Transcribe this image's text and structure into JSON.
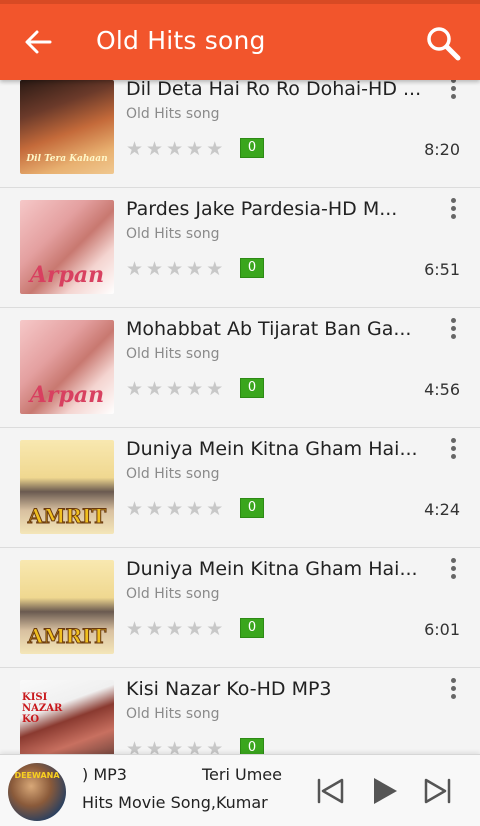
{
  "app_bar": {
    "title": "Old Hits song",
    "back_icon": "arrow-left-icon",
    "search_icon": "search-icon",
    "color": "#f2552c"
  },
  "songs": [
    {
      "title": "Dil Deta Hai Ro Ro Dohai-HD ...",
      "subtitle": "Old Hits song",
      "rating": 0,
      "badge": "0",
      "duration": "8:20",
      "art_label": "Dil Tera Kahaan"
    },
    {
      "title": "Pardes Jake Pardesia-HD M...",
      "subtitle": "Old Hits song",
      "rating": 0,
      "badge": "0",
      "duration": "6:51",
      "art_label": "Arpan"
    },
    {
      "title": "Mohabbat Ab Tijarat Ban Ga...",
      "subtitle": "Old Hits song",
      "rating": 0,
      "badge": "0",
      "duration": "4:56",
      "art_label": "Arpan"
    },
    {
      "title": "Duniya Mein Kitna Gham Hai...",
      "subtitle": "Old Hits song",
      "rating": 0,
      "badge": "0",
      "duration": "4:24",
      "art_label": "AMRIT"
    },
    {
      "title": "Duniya Mein Kitna Gham Hai...",
      "subtitle": "Old Hits song",
      "rating": 0,
      "badge": "0",
      "duration": "6:01",
      "art_label": "AMRIT"
    },
    {
      "title": "Kisi Nazar Ko-HD MP3",
      "subtitle": "Old Hits song",
      "rating": 0,
      "badge": "0",
      "duration": "",
      "art_label": "KISI NAZAR KO"
    }
  ],
  "player": {
    "marquee_left": ") MP3",
    "marquee_right": "Teri Umee",
    "subtitle": "Hits Movie Song,Kumar",
    "art_label": "DEEWANA",
    "prev_icon": "skip-previous-icon",
    "play_icon": "play-icon",
    "next_icon": "skip-next-icon"
  }
}
